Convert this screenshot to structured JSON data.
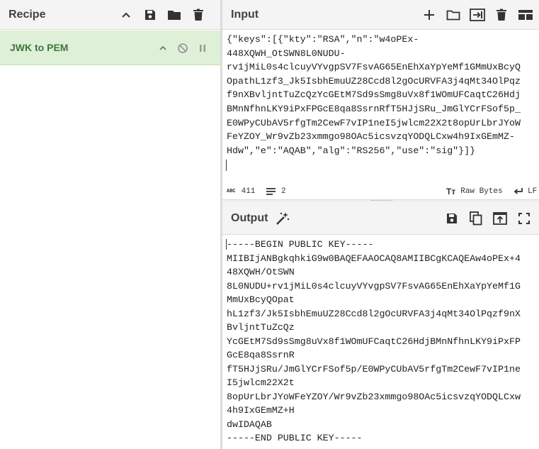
{
  "recipe": {
    "title": "Recipe",
    "operation": "JWK to PEM"
  },
  "input": {
    "title": "Input",
    "lines": [
      "{\"keys\":[{\"kty\":\"RSA\",\"n\":\"w4oPEx-",
      "448XQWH_OtSWN8L0NUDU-",
      "rv1jMiL0s4clcuyVYvgpSV7FsvAG65EnEhXaYpYeMf1GMmUxBcyQ",
      "OpathL1zf3_Jk5IsbhEmuUZ28Ccd8l2gOcURVFA3j4qMt34OlPqz",
      "f9nXBvljntTuZcQzYcGEtM7Sd9sSmg8uVx8f1WOmUFCaqtC26Hdj",
      "BMnNfhnLKY9iPxFPGcE8qa8SsrnRfT5HJjSRu_JmGlYCrFSof5p_",
      "E0WPyCUbAV5rfgTm2CewF7vIP1neI5jwlcm22X2t8opUrLbrJYoW",
      "FeYZOY_Wr9vZb23xmmgo98OAc5icsvzqYODQLCxw4h9IxGEmMZ-",
      "Hdw\",\"e\":\"AQAB\",\"alg\":\"RS256\",\"use\":\"sig\"}]}"
    ],
    "char_count": "411",
    "line_count": "2",
    "raw_bytes_label": "Raw Bytes",
    "line_ending": "LF"
  },
  "output": {
    "title": "Output",
    "lines": [
      "-----BEGIN PUBLIC KEY-----",
      "MIIBIjANBgkqhkiG9w0BAQEFAAOCAQ8AMIIBCgKCAQEAw4oPEx+4",
      "48XQWH/OtSWN",
      "8L0NUDU+rv1jMiL0s4clcuyVYvgpSV7FsvAG65EnEhXaYpYeMf1G",
      "MmUxBcyQOpat",
      "hL1zf3/Jk5IsbhEmuUZ28Ccd8l2gOcURVFA3j4qMt34OlPqzf9nX",
      "BvljntTuZcQz",
      "YcGEtM7Sd9sSmg8uVx8f1WOmUFCaqtC26HdjBMnNfhnLKY9iPxFP",
      "GcE8qa8SsrnR",
      "fT5HJjSRu/JmGlYCrFSof5p/E0WPyCUbAV5rfgTm2CewF7vIP1ne",
      "I5jwlcm22X2t",
      "8opUrLbrJYoWFeYZOY/Wr9vZb23xmmgo98OAc5icsvzqYODQLCxw",
      "4h9IxGEmMZ+H",
      "dwIDAQAB",
      "-----END PUBLIC KEY-----"
    ]
  }
}
